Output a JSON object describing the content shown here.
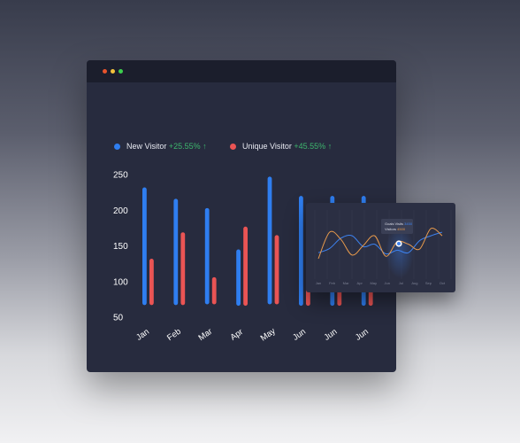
{
  "window": {
    "buttons": [
      {
        "name": "close",
        "color": "#e8532c"
      },
      {
        "name": "minimize",
        "color": "#f3c23c"
      },
      {
        "name": "maximize",
        "color": "#3ccf4e"
      }
    ]
  },
  "legend": [
    {
      "label": "New Visitor",
      "change": "+25.55%",
      "arrow": "↑",
      "color": "#2f7ef0"
    },
    {
      "label": "Unique Visitor",
      "change": "+45.55%",
      "arrow": "↑",
      "color": "#ea5454"
    }
  ],
  "chart_data": [
    {
      "type": "bar",
      "categories": [
        "Jan",
        "Feb",
        "Mar",
        "Apr",
        "May",
        "Jun",
        "Jun",
        "Jun"
      ],
      "y_ticks": [
        250,
        200,
        150,
        100,
        50
      ],
      "ylim": [
        50,
        250
      ],
      "series": [
        {
          "name": "New Visitor",
          "color": "#2f7ef0",
          "values": [
            232,
            216,
            203,
            145,
            247,
            220,
            220,
            220
          ]
        },
        {
          "name": "Unique Visitor",
          "color": "#ea5454",
          "values": [
            132,
            169,
            106,
            177,
            165,
            118,
            118,
            118
          ]
        }
      ],
      "baselines": [
        67,
        67,
        68,
        66,
        68,
        66,
        66,
        66
      ]
    },
    {
      "type": "line",
      "x_labels": [
        "Jan",
        "Feb",
        "Mar",
        "Apr",
        "May",
        "Jun",
        "Jul",
        "Aug",
        "Sep",
        "Oct"
      ],
      "series": [
        {
          "color": "#3d82ef",
          "values": [
            0.62,
            0.55,
            0.38,
            0.34,
            0.52,
            0.48,
            0.64,
            0.58,
            0.62,
            0.42,
            0.34,
            0.28
          ]
        },
        {
          "color": "#e89a4c",
          "values": [
            0.72,
            0.28,
            0.4,
            0.66,
            0.5,
            0.34,
            0.68,
            0.44,
            0.48,
            0.56,
            0.22,
            0.34
          ]
        }
      ],
      "tooltip": {
        "line1": "Goals Visits",
        "value1": "3450",
        "value1_color": "#3d82ef",
        "line2": "Visitors",
        "value2": "4500",
        "value2_color": "#e89a4c"
      }
    }
  ]
}
